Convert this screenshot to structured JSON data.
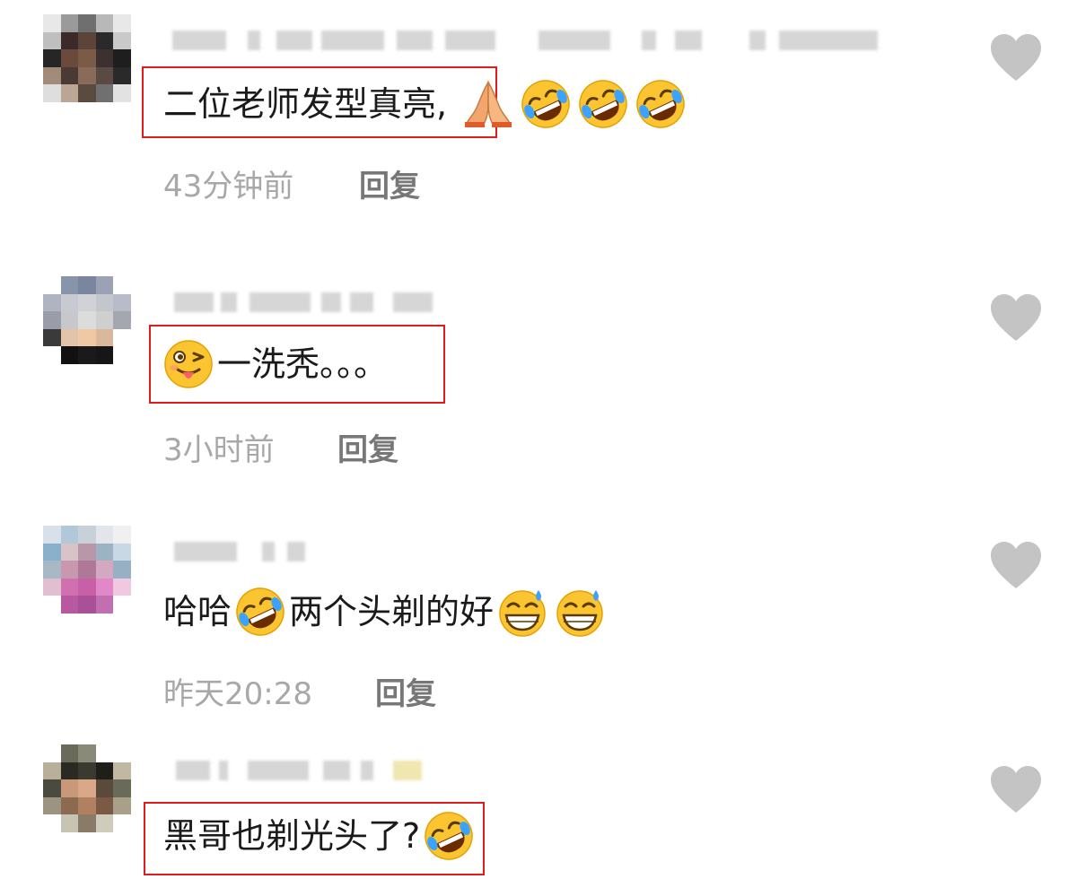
{
  "comments": [
    {
      "text": "二位老师发型真亮",
      "suffix": ",",
      "emojis": [
        "folded-hands",
        "rofl",
        "rofl",
        "rofl"
      ],
      "time": "43分钟前",
      "reply": "回复"
    },
    {
      "text": "一洗秃。。。",
      "prefix_emoji": "winking-tongue",
      "time": "3小时前",
      "reply": "回复"
    },
    {
      "text_a": "哈哈",
      "text_b": "两个头剃的好",
      "emojis": [
        "rofl",
        "grinning-sweat",
        "grinning-sweat"
      ],
      "time": "昨天20:28",
      "reply": "回复"
    },
    {
      "text": "黑哥也剃光头了?",
      "emojis": [
        "rofl"
      ]
    }
  ],
  "colors": {
    "highlight": "#e01b1b",
    "heart": "#c4c4c4",
    "meta": "#a8a8a8",
    "reply": "#777777"
  }
}
